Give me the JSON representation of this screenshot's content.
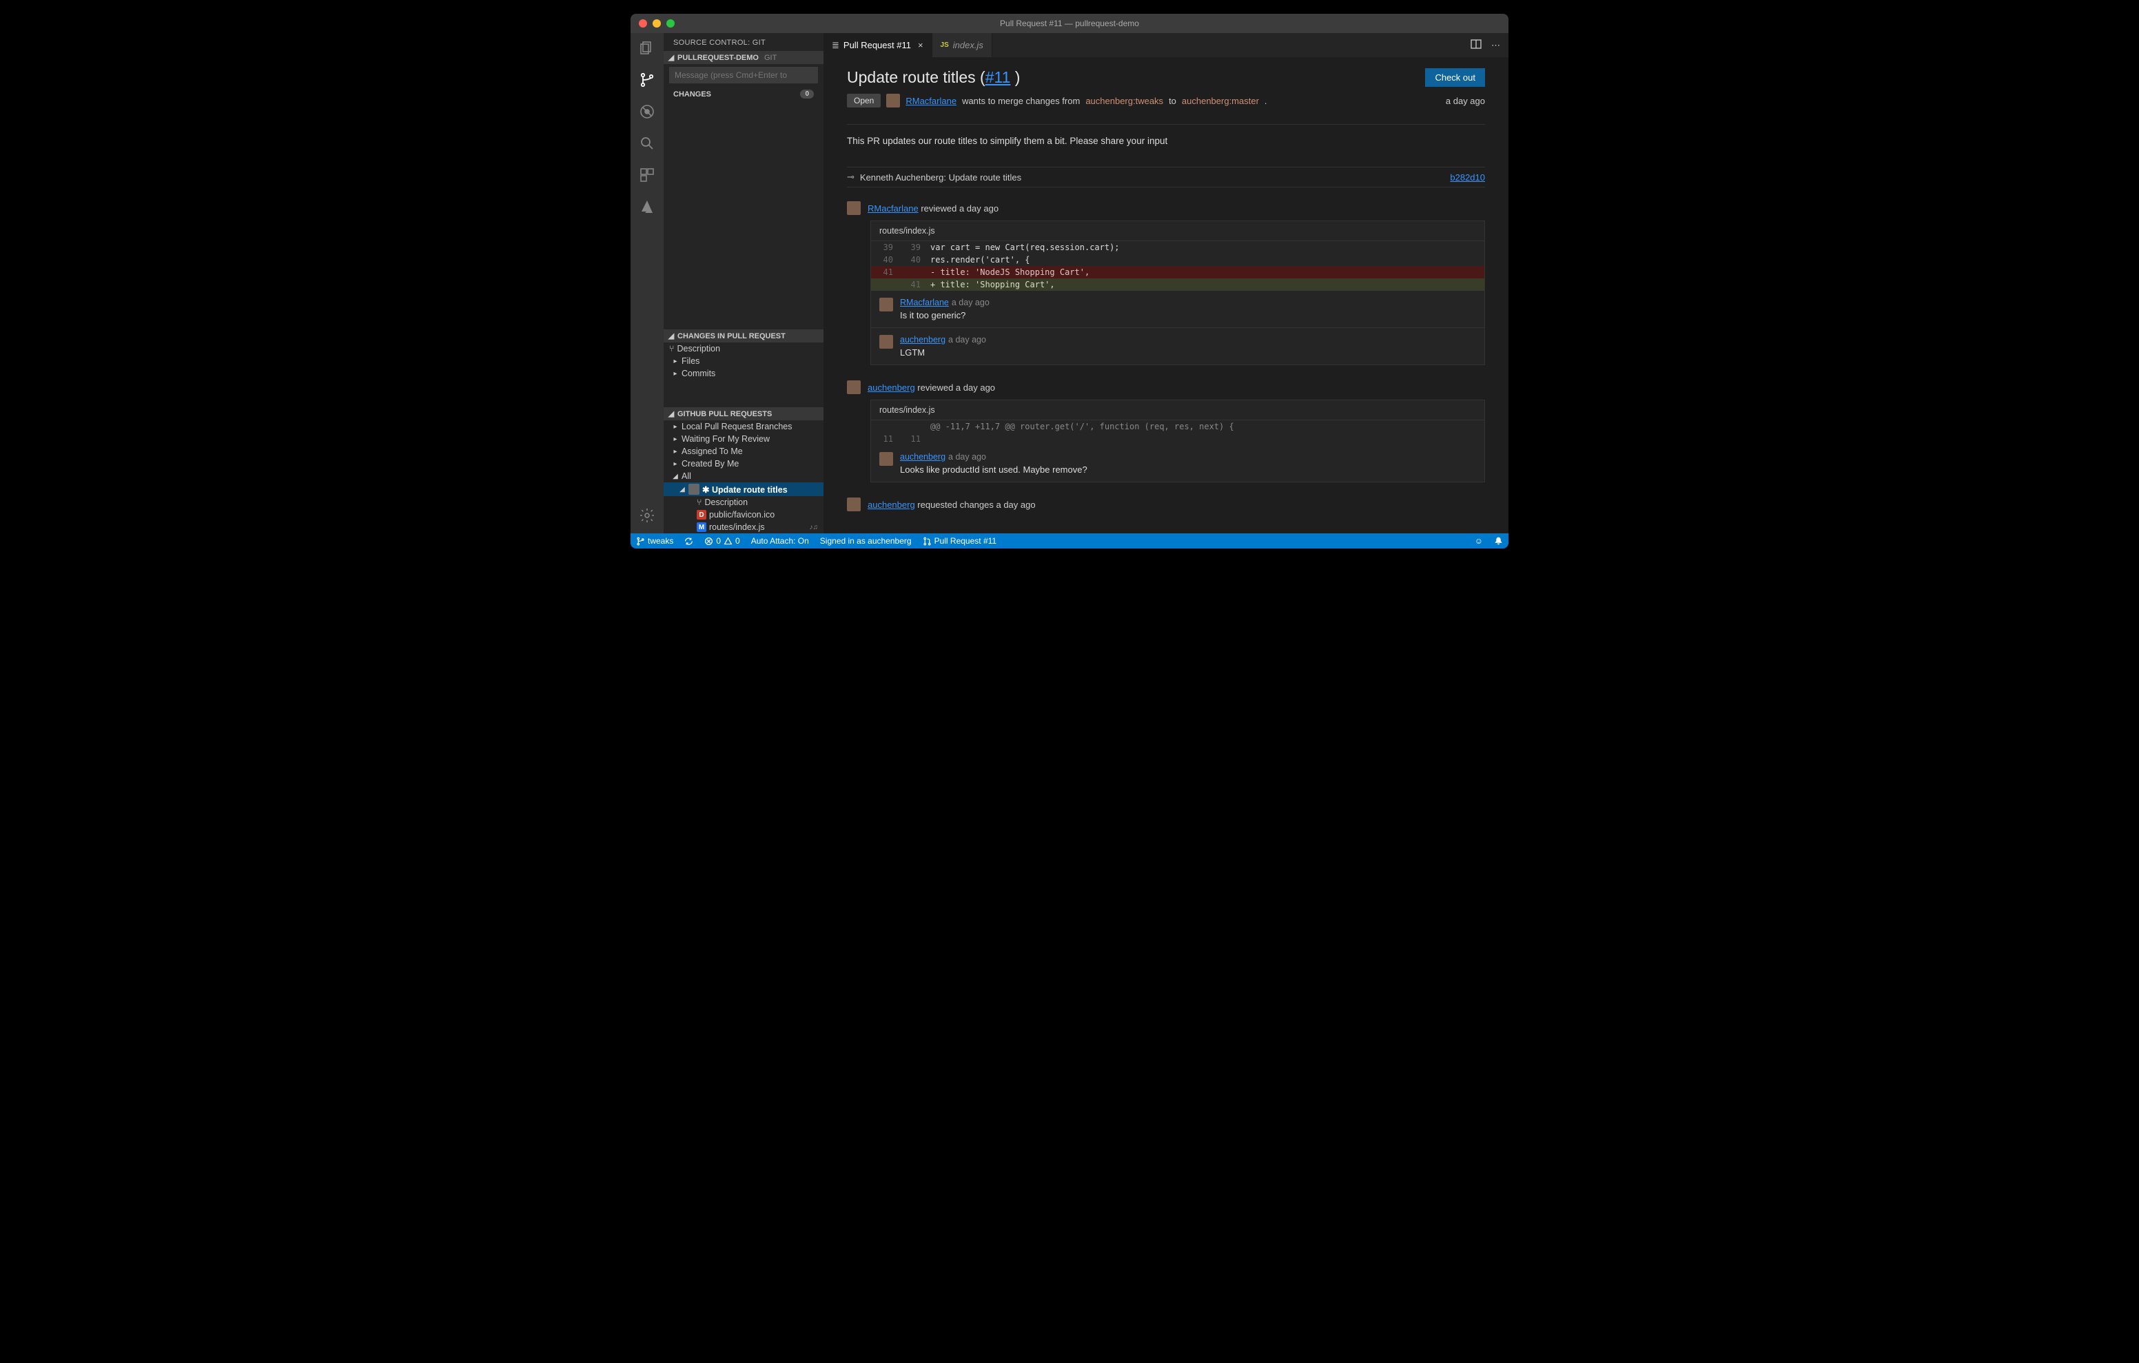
{
  "window_title": "Pull Request #11 — pullrequest-demo",
  "sidebar": {
    "title": "SOURCE CONTROL: GIT",
    "repo_header": "PULLREQUEST-DEMO",
    "repo_ext": "GIT",
    "commit_placeholder": "Message (press Cmd+Enter to",
    "changes_label": "CHANGES",
    "changes_count": "0",
    "pr_panel": "CHANGES IN PULL REQUEST",
    "pr_items": {
      "desc": "Description",
      "files": "Files",
      "commits": "Commits"
    },
    "gh_panel": "GITHUB PULL REQUESTS",
    "gh": {
      "local": "Local Pull Request Branches",
      "waiting": "Waiting For My Review",
      "assigned": "Assigned To Me",
      "created": "Created By Me",
      "all": "All",
      "selected": "✱ Update route titles",
      "sub_desc": "Description",
      "sub_favicon": "public/favicon.ico",
      "sub_routes": "routes/index.js",
      "music": "♪♫"
    }
  },
  "tabs": {
    "active": "Pull Request #11",
    "inactive": "index.js"
  },
  "pr": {
    "title_a": "Update route titles (",
    "title_link": "#11",
    "title_b": " )",
    "checkout": "Check out",
    "state": "Open",
    "user": "RMacfarlane",
    "merge_a": " wants to merge changes from ",
    "branch_from": "auchenberg:tweaks",
    "merge_b": " to ",
    "branch_to": "auchenberg:master",
    "dot": ".",
    "time": "a day ago",
    "description": "This PR updates our route titles to simplify them a bit. Please share your input",
    "commit_author": "Kenneth Auchenberg: Update route titles",
    "commit_sha": "b282d10"
  },
  "review1": {
    "user": "RMacfarlane",
    "action": " reviewed a day ago",
    "file": "routes/index.js",
    "l1": {
      "old": "39",
      "new": "39",
      "code": "var cart = new Cart(req.session.cart);"
    },
    "l2": {
      "old": "40",
      "new": "40",
      "code": "res.render('cart', {"
    },
    "l3": {
      "old": "41",
      "new": "",
      "code": "- title: 'NodeJS Shopping Cart',"
    },
    "l4": {
      "old": "",
      "new": "41",
      "code": "+ title: 'Shopping Cart',"
    },
    "c1": {
      "user": "RMacfarlane",
      "time": "a day ago",
      "body": "Is it too generic?"
    },
    "c2": {
      "user": "auchenberg",
      "time": "a day ago",
      "body": "LGTM"
    }
  },
  "review2": {
    "user": "auchenberg",
    "action": " reviewed a day ago",
    "file": "routes/index.js",
    "hunk": {
      "old": "",
      "new": "",
      "code": "@@ -11,7 +11,7 @@ router.get('/', function (req, res, next) {"
    },
    "l1": {
      "old": "11",
      "new": "11",
      "code": ""
    },
    "c1": {
      "user": "auchenberg",
      "time": "a day ago",
      "body": "Looks like productId isnt used. Maybe remove?"
    }
  },
  "review3": {
    "user": "auchenberg",
    "action": " requested changes a day ago"
  },
  "statusbar": {
    "branch": "tweaks",
    "errors": "0",
    "warnings": "0",
    "auto": "Auto Attach: On",
    "signed": "Signed in as auchenberg",
    "pr": "Pull Request #11"
  }
}
